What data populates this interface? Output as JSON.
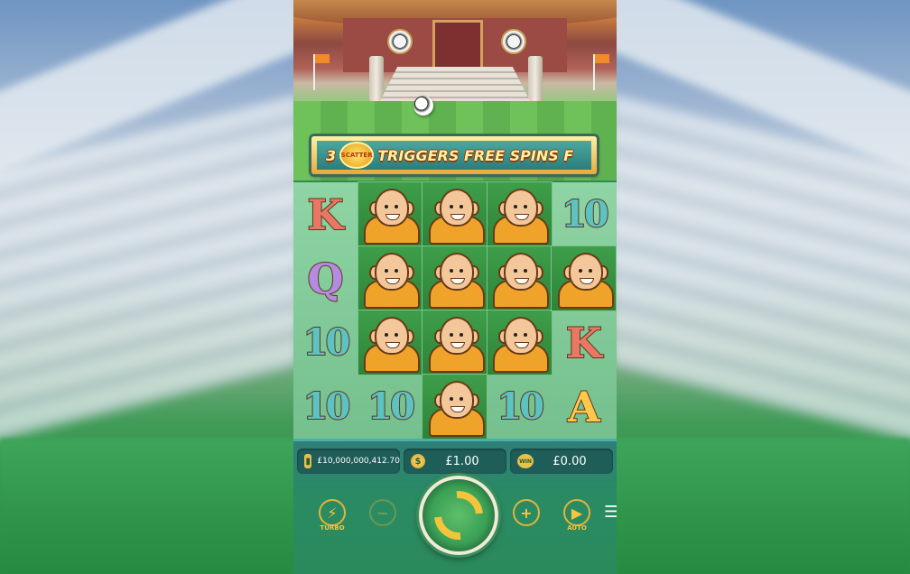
{
  "banner": {
    "number": "3",
    "scatter_label": "SCATTER",
    "text": "TRIGGERS FREE SPINS F"
  },
  "reels": [
    [
      "K",
      "Q",
      "10",
      "10"
    ],
    [
      "monk",
      "monk",
      "monk",
      "10"
    ],
    [
      "monk",
      "monk",
      "monk",
      "monk"
    ],
    [
      "monk",
      "monk",
      "monk",
      "10"
    ],
    [
      "10",
      "monk",
      "K",
      "A"
    ]
  ],
  "balance": {
    "value": "£10,000,000,412.70",
    "icon": "wallet-icon"
  },
  "bet": {
    "value": "£1.00",
    "icon": "coins-icon"
  },
  "win": {
    "value": "£0.00",
    "icon": "win-icon",
    "icon_label": "WIN"
  },
  "controls": {
    "turbo_label": "TURBO",
    "auto_label": "AUTO",
    "minus_symbol": "−",
    "plus_symbol": "+",
    "menu_symbol": "☰"
  },
  "colors": {
    "accent_gold": "#f4c543",
    "panel_green": "#2b8a5c"
  }
}
